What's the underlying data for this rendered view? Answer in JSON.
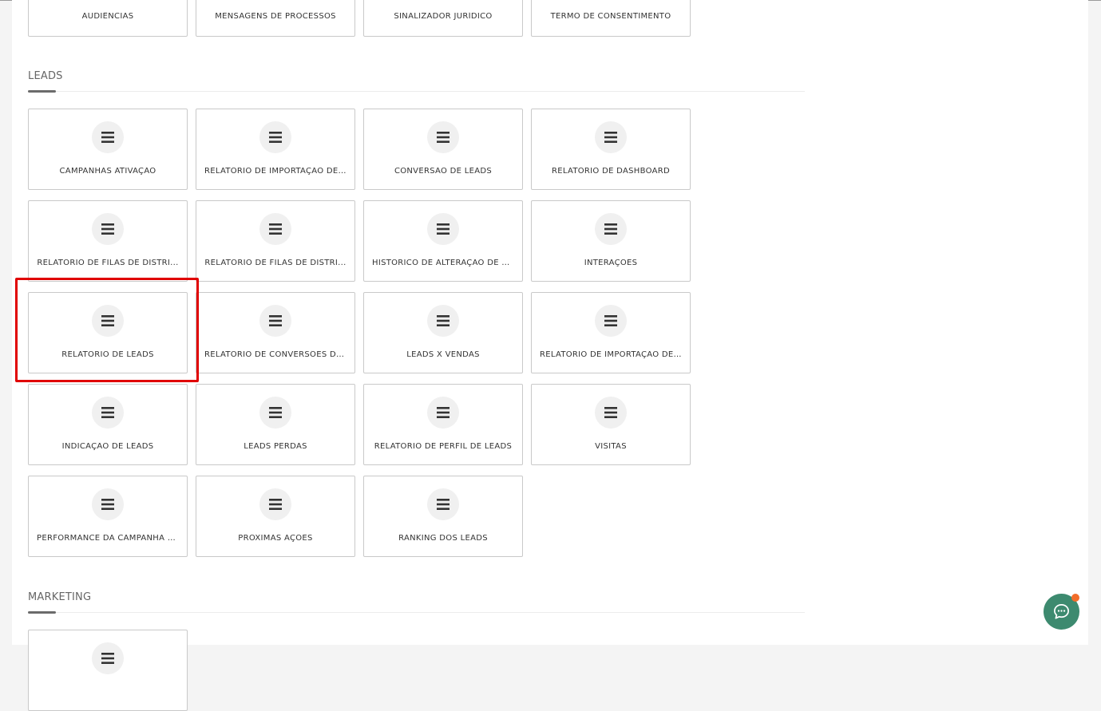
{
  "top_row": {
    "items": [
      {
        "label": "AUDIÊNCIAS"
      },
      {
        "label": "MENSAGENS DE PROCESSOS"
      },
      {
        "label": "SINALIZADOR JURÍDICO"
      },
      {
        "label": "TERMO DE CONSENTIMENTO"
      }
    ]
  },
  "leads": {
    "title": "LEADS",
    "items": [
      {
        "label": "CAMPANHAS ATIVAÇÃO",
        "icon": "list-icon"
      },
      {
        "label": "RELATÓRIO DE IMPORTAÇÃO DE ...",
        "icon": "list-icon"
      },
      {
        "label": "CONVERSÃO DE LEADS",
        "icon": "list-icon"
      },
      {
        "label": "RELATÓRIO DE DASHBOARD",
        "icon": "list-icon"
      },
      {
        "label": "RELATÓRIO DE FILAS DE DISTRI...",
        "icon": "list-icon"
      },
      {
        "label": "RELATÓRIO DE FILAS DE DISTRI...",
        "icon": "list-icon"
      },
      {
        "label": "HISTÓRICO DE ALTERAÇÃO DE L...",
        "icon": "list-icon"
      },
      {
        "label": "INTERAÇÕES",
        "icon": "list-icon"
      },
      {
        "label": "RELATÓRIO DE LEADS",
        "icon": "list-icon"
      },
      {
        "label": "RELATÓRIO DE CONVERSÕES DE...",
        "icon": "list-icon"
      },
      {
        "label": "LEADS X VENDAS",
        "icon": "list-icon"
      },
      {
        "label": "RELATÓRIO DE IMPORTAÇÃO DE ...",
        "icon": "list-icon"
      },
      {
        "label": "INDICAÇÃO DE LEADS",
        "icon": "list-icon"
      },
      {
        "label": "LEADS PERDAS",
        "icon": "list-icon"
      },
      {
        "label": "RELATÓRIO DE PERFIL DE LEADS",
        "icon": "list-icon"
      },
      {
        "label": "VISITAS",
        "icon": "list-icon"
      },
      {
        "label": "PERFORMANCE DA CAMPANHA D...",
        "icon": "list-icon"
      },
      {
        "label": "PRÓXIMAS AÇÕES",
        "icon": "list-icon"
      },
      {
        "label": "RANKING DOS LEADS",
        "icon": "list-icon"
      }
    ]
  },
  "marketing": {
    "title": "MARKETING"
  },
  "colors": {
    "highlight": "#e00000",
    "chat_button": "#3d8a6f",
    "notification_dot": "#f26d2a"
  },
  "chat": {
    "icon": "chat-bubble-icon"
  }
}
